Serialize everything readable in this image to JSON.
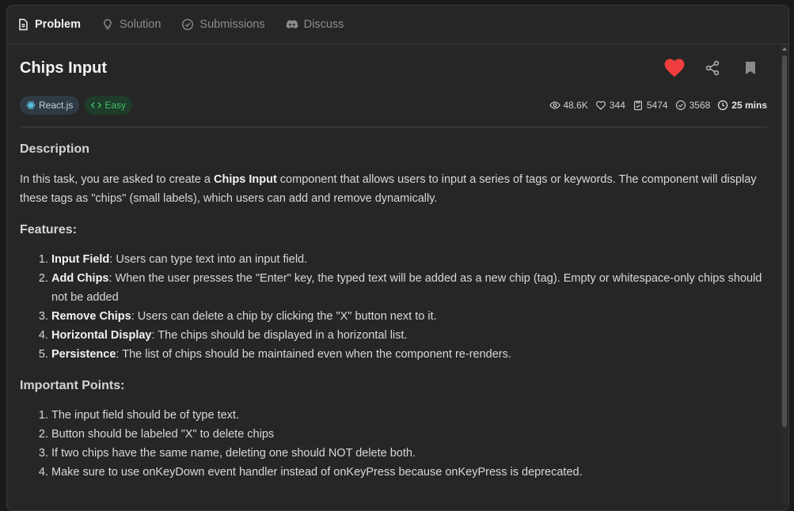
{
  "tabs": [
    {
      "label": "Problem",
      "icon": "document-icon",
      "active": true
    },
    {
      "label": "Solution",
      "icon": "lightbulb-icon",
      "active": false
    },
    {
      "label": "Submissions",
      "icon": "check-circle-icon",
      "active": false
    },
    {
      "label": "Discuss",
      "icon": "discord-icon",
      "active": false
    }
  ],
  "problem": {
    "title": "Chips Input",
    "tags": {
      "tech": "React.js",
      "difficulty": "Easy"
    },
    "stats": {
      "views": "48.6K",
      "likes": "344",
      "submissions": "5474",
      "solved": "3568",
      "time": "25 mins"
    },
    "liked": true,
    "colors": {
      "like": "#f03e3e",
      "easy": "#3fc46a",
      "react": "#61dafb"
    }
  },
  "description": {
    "heading": "Description",
    "p_before": "In this task, you are asked to create a ",
    "p_bold": "Chips Input",
    "p_after": " component that allows users to input a series of tags or keywords. The component will display these tags as \"chips\" (small labels), which users can add and remove dynamically."
  },
  "features": {
    "heading": "Features:",
    "items": [
      {
        "bold": "Input Field",
        "text": ": Users can type text into an input field."
      },
      {
        "bold": "Add Chips",
        "text": ": When the user presses the \"Enter\" key, the typed text will be added as a new chip (tag). Empty or whitespace-only chips should not be added"
      },
      {
        "bold": "Remove Chips",
        "text": ": Users can delete a chip by clicking the \"X\" button next to it."
      },
      {
        "bold": "Horizontal Display",
        "text": ": The chips should be displayed in a horizontal list."
      },
      {
        "bold": "Persistence",
        "text": ": The list of chips should be maintained even when the component re-renders."
      }
    ]
  },
  "important": {
    "heading": "Important Points:",
    "items": [
      "The input field should be of type text.",
      "Button should be labeled \"X\" to delete chips",
      "If two chips have the same name, deleting one should NOT delete both.",
      "Make sure to use onKeyDown event handler instead of onKeyPress because onKeyPress is deprecated."
    ]
  }
}
